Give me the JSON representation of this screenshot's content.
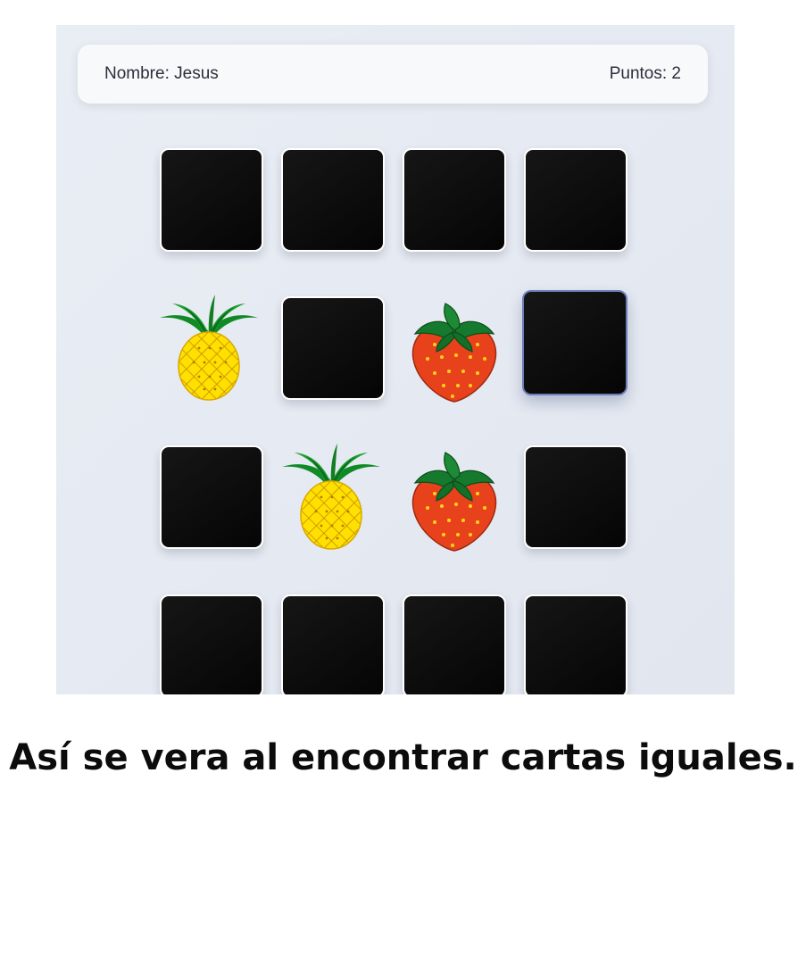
{
  "header": {
    "name_text": "Nombre: Jesus",
    "score_text": "Puntos: 2"
  },
  "board": {
    "rows": [
      [
        "back",
        "back",
        "back",
        "back"
      ],
      [
        "pineapple",
        "back",
        "strawberry",
        "back-selected"
      ],
      [
        "back",
        "pineapple",
        "strawberry",
        "back"
      ],
      [
        "back",
        "back",
        "back",
        "back"
      ]
    ]
  },
  "caption": "Así se vera al encontrar cartas iguales."
}
